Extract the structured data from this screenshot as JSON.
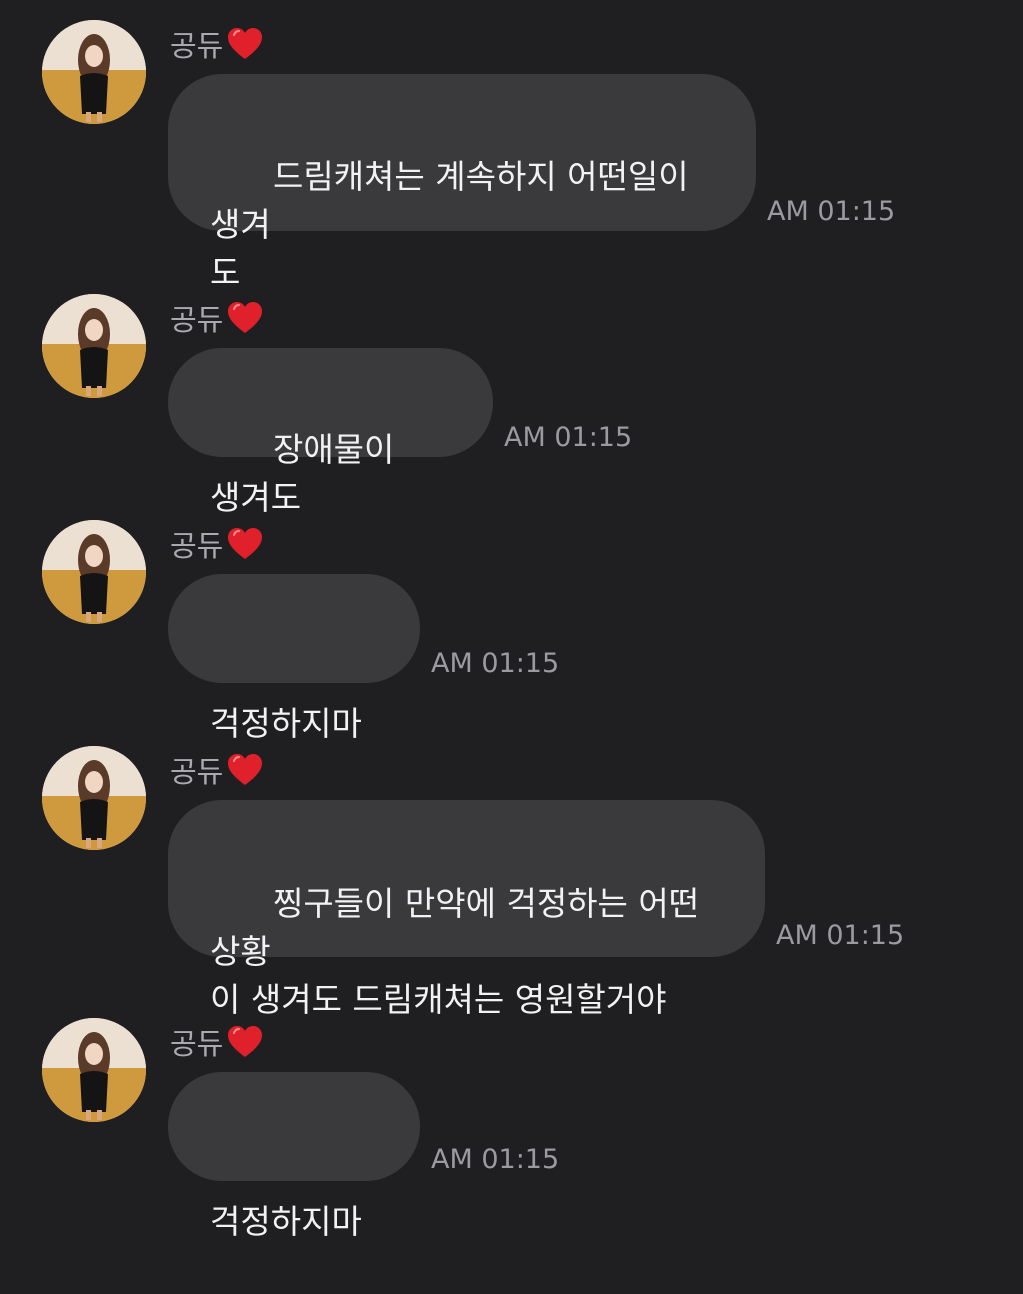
{
  "chat": {
    "messages": [
      {
        "sender": "공듀",
        "sender_badge": "heart",
        "text": "드림캐쳐는 계속하지 어떤일이 생겨\n도",
        "time": "AM 01:15"
      },
      {
        "sender": "공듀",
        "sender_badge": "heart",
        "text": "장애물이 생겨도",
        "time": "AM 01:15"
      },
      {
        "sender": "공듀",
        "sender_badge": "heart",
        "text": "걱정하지마",
        "time": "AM 01:15"
      },
      {
        "sender": "공듀",
        "sender_badge": "heart",
        "text": "찡구들이 만약에 걱정하는 어떤 상황\n이 생겨도 드림캐쳐는 영원할거야",
        "time": "AM 01:15"
      },
      {
        "sender": "공듀",
        "sender_badge": "heart",
        "text": "걱정하지마",
        "time": "AM 01:15"
      }
    ]
  },
  "colors": {
    "background": "#1f1f22",
    "bubble": "#3a3a3d",
    "bubble_text": "#f2f2f4",
    "sender_text": "#a9a9ae",
    "time_text": "#9a9a9f",
    "heart": "#e0202a"
  },
  "icons": {
    "sender_badge": "red-heart-icon",
    "avatar": "profile-photo"
  }
}
